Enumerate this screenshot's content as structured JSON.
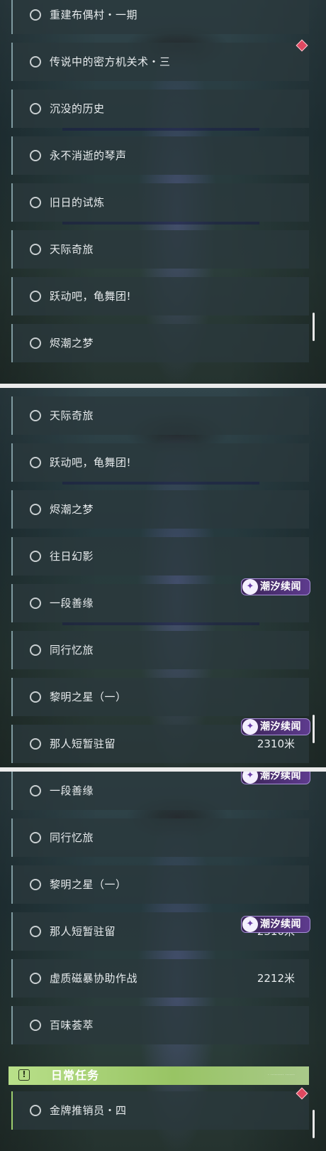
{
  "panel1": {
    "items": [
      {
        "label": "重建布偶村・一期"
      },
      {
        "label": "传说中的密方机关术・三"
      },
      {
        "label": "沉没的历史"
      },
      {
        "label": "永不消逝的琴声"
      },
      {
        "label": "旧日的试炼"
      },
      {
        "label": "天际奇旅"
      },
      {
        "label": "跃动吧，龟舞团!"
      },
      {
        "label": "烬潮之梦"
      }
    ]
  },
  "panel2": {
    "items": [
      {
        "label": "天际奇旅"
      },
      {
        "label": "跃动吧，龟舞团!"
      },
      {
        "label": "烬潮之梦"
      },
      {
        "label": "往日幻影"
      },
      {
        "label": "一段善缘"
      },
      {
        "label": "同行忆旅"
      },
      {
        "label": "黎明之星（一）"
      },
      {
        "label": "那人短暂驻留",
        "distance": "2310米"
      }
    ]
  },
  "panel3": {
    "items": [
      {
        "label": "一段善缘"
      },
      {
        "label": "同行忆旅"
      },
      {
        "label": "黎明之星（一）"
      },
      {
        "label": "那人短暂驻留",
        "distance": "2310米"
      },
      {
        "label": "虚质磁暴协助作战",
        "distance": "2212米"
      },
      {
        "label": "百味荟萃"
      }
    ],
    "daily_header": {
      "label": "日常任务",
      "small_text": "· ·········· ·······",
      "icon": "exclamation-icon"
    },
    "daily_items": [
      {
        "label": "金牌推销员・四"
      }
    ]
  },
  "badge": {
    "label": "潮汐续闻",
    "icon": "tide-swirl-icon"
  },
  "colors": {
    "row_bg": "#2a383c",
    "badge_purple": "#5e3b8e",
    "daily_green": "#a9d47a",
    "tracking_diamond": "#e04860"
  }
}
